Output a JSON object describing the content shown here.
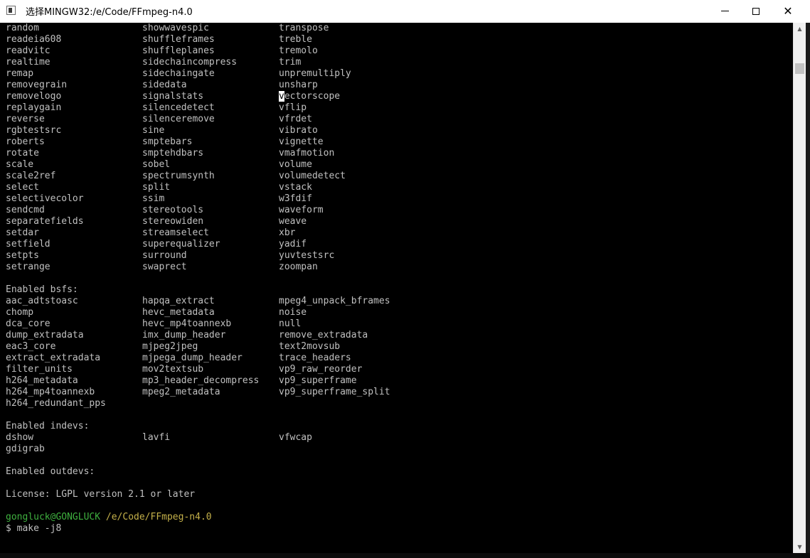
{
  "window": {
    "title": "选择MINGW32:/e/Code/FFmpeg-n4.0",
    "icon": "terminal-icon",
    "controls": {
      "minimize": "minimize-icon",
      "maximize": "maximize-icon",
      "close_glyph": "✕"
    }
  },
  "console": {
    "filter_rows": [
      [
        "random",
        "showwavespic",
        "transpose"
      ],
      [
        "readeia608",
        "shuffleframes",
        "treble"
      ],
      [
        "readvitc",
        "shuffleplanes",
        "tremolo"
      ],
      [
        "realtime",
        "sidechaincompress",
        "trim"
      ],
      [
        "remap",
        "sidechaingate",
        "unpremultiply"
      ],
      [
        "removegrain",
        "sidedata",
        "unsharp"
      ],
      [
        "removelogo",
        "signalstats",
        "vectorscope"
      ],
      [
        "replaygain",
        "silencedetect",
        "vflip"
      ],
      [
        "reverse",
        "silenceremove",
        "vfrdet"
      ],
      [
        "rgbtestsrc",
        "sine",
        "vibrato"
      ],
      [
        "roberts",
        "smptebars",
        "vignette"
      ],
      [
        "rotate",
        "smptehdbars",
        "vmafmotion"
      ],
      [
        "scale",
        "sobel",
        "volume"
      ],
      [
        "scale2ref",
        "spectrumsynth",
        "volumedetect"
      ],
      [
        "select",
        "split",
        "vstack"
      ],
      [
        "selectivecolor",
        "ssim",
        "w3fdif"
      ],
      [
        "sendcmd",
        "stereotools",
        "waveform"
      ],
      [
        "separatefields",
        "stereowiden",
        "weave"
      ],
      [
        "setdar",
        "streamselect",
        "xbr"
      ],
      [
        "setfield",
        "superequalizer",
        "yadif"
      ],
      [
        "setpts",
        "surround",
        "yuvtestsrc"
      ],
      [
        "setrange",
        "swaprect",
        "zoompan"
      ]
    ],
    "cursor_row_index": 6,
    "bsfs_header": "Enabled bsfs:",
    "bsfs_rows": [
      [
        "aac_adtstoasc",
        "hapqa_extract",
        "mpeg4_unpack_bframes"
      ],
      [
        "chomp",
        "hevc_metadata",
        "noise"
      ],
      [
        "dca_core",
        "hevc_mp4toannexb",
        "null"
      ],
      [
        "dump_extradata",
        "imx_dump_header",
        "remove_extradata"
      ],
      [
        "eac3_core",
        "mjpeg2jpeg",
        "text2movsub"
      ],
      [
        "extract_extradata",
        "mjpega_dump_header",
        "trace_headers"
      ],
      [
        "filter_units",
        "mov2textsub",
        "vp9_raw_reorder"
      ],
      [
        "h264_metadata",
        "mp3_header_decompress",
        "vp9_superframe"
      ],
      [
        "h264_mp4toannexb",
        "mpeg2_metadata",
        "vp9_superframe_split"
      ],
      [
        "h264_redundant_pps",
        "",
        ""
      ]
    ],
    "indevs_header": "Enabled indevs:",
    "indevs_rows": [
      [
        "dshow",
        "lavfi",
        "vfwcap"
      ],
      [
        "gdigrab",
        "",
        ""
      ]
    ],
    "outdevs_header": "Enabled outdevs:",
    "license": "License: LGPL version 2.1 or later",
    "prompt_user": "gongluck@GONGLUCK",
    "prompt_path": "/e/Code/FFmpeg-n4.0",
    "command": "$ make -j8",
    "colors": {
      "background": "#000000",
      "text": "#c0c0c0",
      "prompt_user": "#3fb13f",
      "prompt_path": "#c5b14a"
    }
  },
  "scrollbar": {
    "up_arrow": "▲",
    "down_arrow": "▼"
  }
}
